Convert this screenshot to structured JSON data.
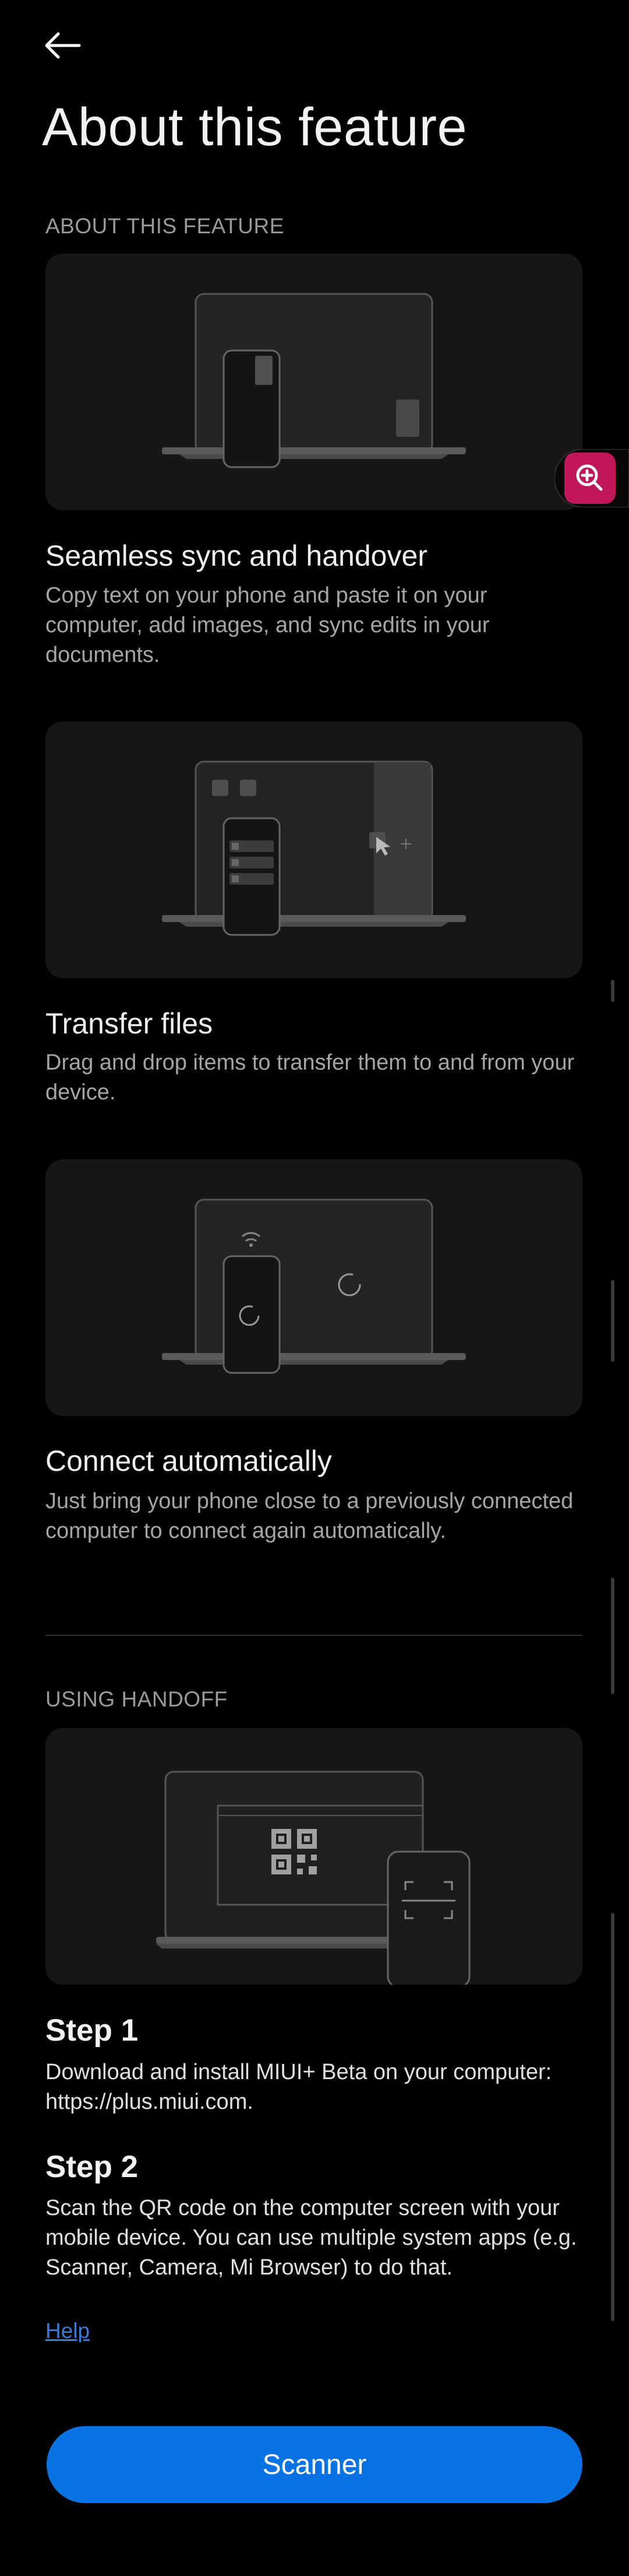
{
  "header": {
    "back_icon": "back-arrow-icon",
    "title": "About this feature"
  },
  "about_section": {
    "header": "ABOUT THIS FEATURE",
    "features": [
      {
        "title": "Seamless sync and handover",
        "description": "Copy text on your phone and paste it on your computer, add images, and sync edits in your documents."
      },
      {
        "title": "Transfer files",
        "description": "Drag and drop items to transfer them to and from your device."
      },
      {
        "title": "Connect automatically",
        "description": "Just bring your phone close to a previously connected computer to connect again automatically."
      }
    ]
  },
  "handoff_section": {
    "header": "USING HANDOFF",
    "steps": [
      {
        "title": "Step 1",
        "description": "Download and install MIUI+ Beta on your computer: https://plus.miui.com."
      },
      {
        "title": "Step 2",
        "description": "Scan the QR code on the computer screen with your mobile device. You can use multiple system apps (e.g. Scanner, Camera, Mi Browser) to do that."
      }
    ],
    "help_link": "Help"
  },
  "primary_button": "Scanner",
  "floating_button": {
    "icon": "zoom-in-icon"
  },
  "colors": {
    "background": "#000000",
    "card": "#161616",
    "accent_button": "#0a73e4",
    "link": "#3a7ad9",
    "floating_button": "#c0175a"
  }
}
